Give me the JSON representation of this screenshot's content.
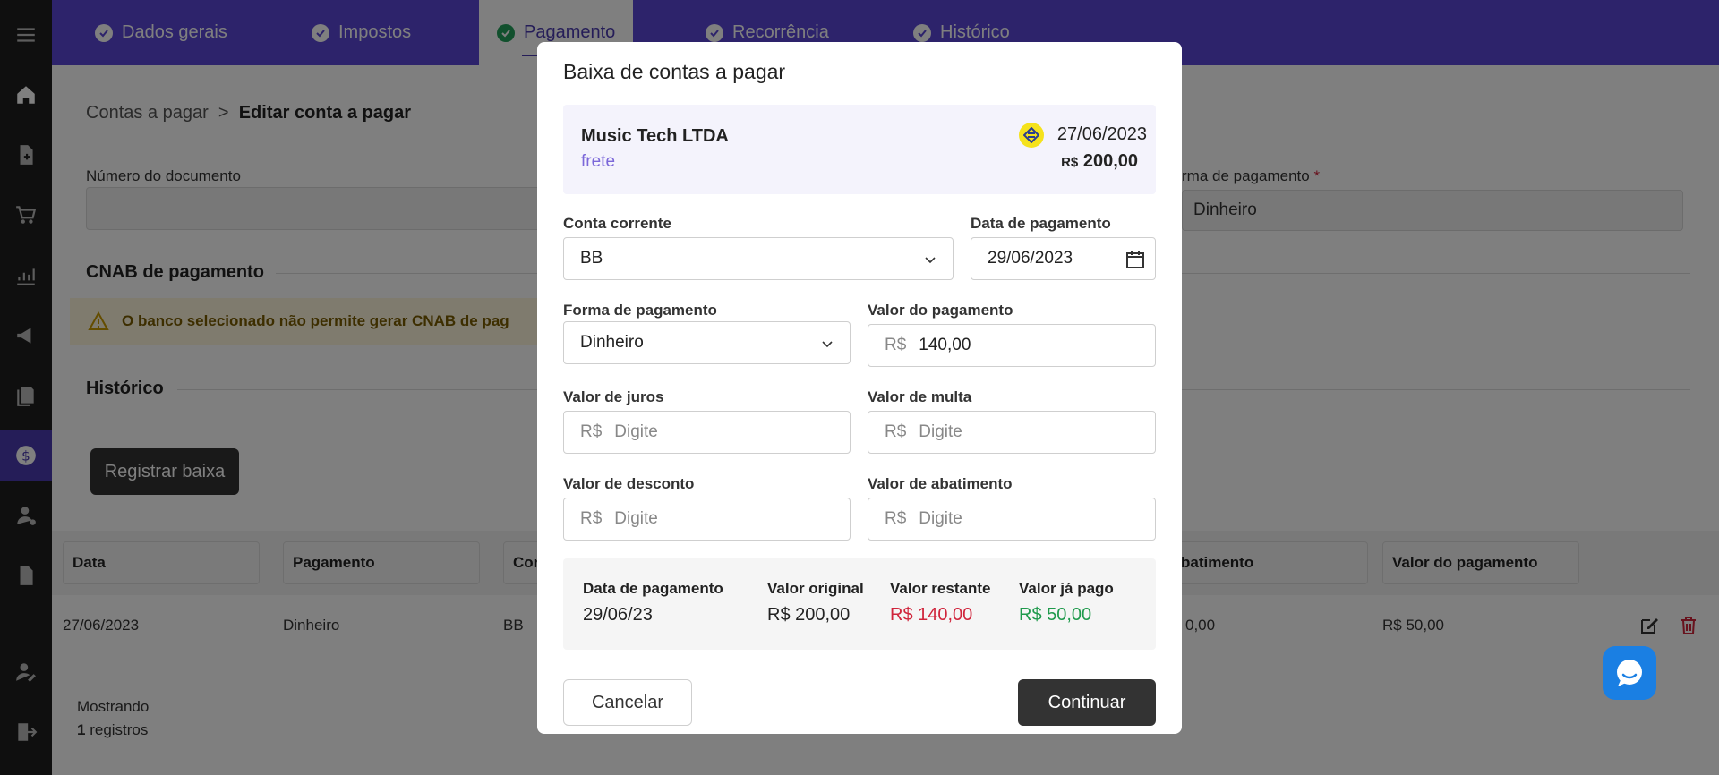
{
  "topbar": {
    "tabs": [
      {
        "label": "Dados gerais"
      },
      {
        "label": "Impostos"
      },
      {
        "label": "Pagamento"
      },
      {
        "label": "Recorrência"
      },
      {
        "label": "Histórico"
      }
    ]
  },
  "breadcrumb": {
    "root": "Contas a pagar",
    "separator": ">",
    "current": "Editar conta a pagar"
  },
  "form": {
    "numero_label": "Número do documento",
    "forma_label": "rma de pagamento",
    "forma_required": "*",
    "forma_value": "Dinheiro",
    "cnab_title": "CNAB de pagamento",
    "cnab_warning": "O banco selecionado não permite gerar CNAB de pag",
    "historico_title": "Histórico",
    "registrar_button": "Registrar baixa"
  },
  "table": {
    "headers": [
      "Data",
      "Pagamento",
      "Cor",
      "batimento",
      "Valor do pagamento"
    ],
    "row": {
      "data": "27/06/2023",
      "pagamento": "Dinheiro",
      "conta": "BB",
      "abatimento": "0,00",
      "valor": "R$ 50,00"
    },
    "footer_label": "Mostrando",
    "footer_count": "1",
    "footer_suffix": "registros"
  },
  "modal": {
    "title": "Baixa de contas a pagar",
    "summary": {
      "company": "Music Tech LTDA",
      "description": "frete",
      "date": "27/06/2023",
      "currency": "R$",
      "amount": "200,00"
    },
    "conta_corrente": {
      "label": "Conta corrente",
      "value": "BB"
    },
    "data_pagamento": {
      "label": "Data de pagamento",
      "value": "29/06/2023"
    },
    "forma_pagamento": {
      "label": "Forma de pagamento",
      "value": "Dinheiro"
    },
    "valor_pagamento": {
      "label": "Valor do pagamento",
      "prefix": "R$",
      "value": "140,00"
    },
    "valor_juros": {
      "label": "Valor de juros",
      "prefix": "R$",
      "placeholder": "Digite"
    },
    "valor_multa": {
      "label": "Valor de multa",
      "prefix": "R$",
      "placeholder": "Digite"
    },
    "valor_desconto": {
      "label": "Valor de desconto",
      "prefix": "R$",
      "placeholder": "Digite"
    },
    "valor_abatimento": {
      "label": "Valor de abatimento",
      "prefix": "R$",
      "placeholder": "Digite"
    },
    "info": {
      "data_label": "Data de pagamento",
      "data_value": "29/06/23",
      "original_label": "Valor original",
      "original_value": "R$ 200,00",
      "restante_label": "Valor restante",
      "restante_value": "R$ 140,00",
      "pago_label": "Valor já pago",
      "pago_value": "R$ 50,00"
    },
    "cancel_button": "Cancelar",
    "continue_button": "Continuar"
  },
  "colors": {
    "accent": "#5b46d6",
    "sidebar": "#1f1f1f",
    "danger": "#d0243b",
    "success": "#1f9a4c"
  }
}
